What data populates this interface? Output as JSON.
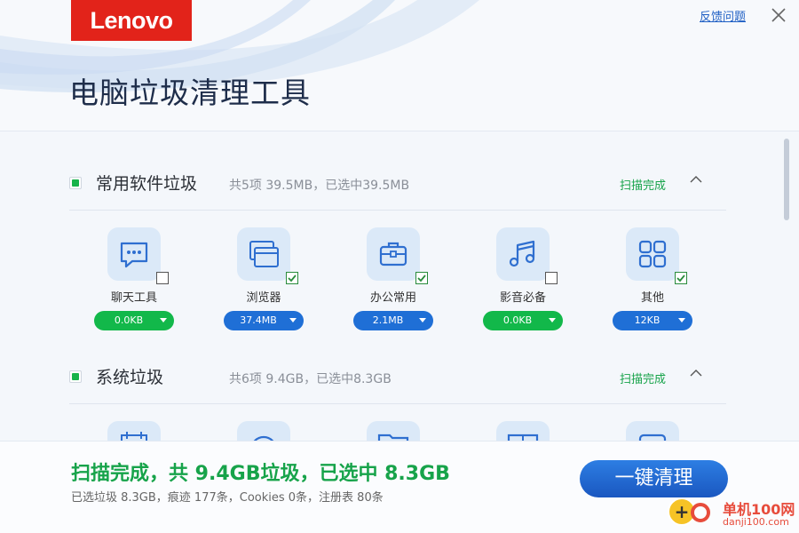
{
  "header": {
    "logo_text": "Lenovo",
    "feedback_label": "反馈问题",
    "title": "电脑垃圾清理工具"
  },
  "sections": [
    {
      "title": "常用软件垃圾",
      "info": "共5项 39.5MB，已选中39.5MB",
      "status": "扫描完成",
      "checked": true,
      "items": [
        {
          "label": "聊天工具",
          "size": "0.0KB",
          "checked": false,
          "pill_color": "green",
          "icon": "chat-bubble-icon"
        },
        {
          "label": "浏览器",
          "size": "37.4MB",
          "checked": true,
          "pill_color": "blue",
          "icon": "browser-windows-icon"
        },
        {
          "label": "办公常用",
          "size": "2.1MB",
          "checked": true,
          "pill_color": "blue",
          "icon": "briefcase-icon"
        },
        {
          "label": "影音必备",
          "size": "0.0KB",
          "checked": false,
          "pill_color": "green",
          "icon": "music-note-icon"
        },
        {
          "label": "其他",
          "size": "12KB",
          "checked": true,
          "pill_color": "blue",
          "icon": "grid-apps-icon"
        }
      ]
    },
    {
      "title": "系统垃圾",
      "info": "共6项 9.4GB，已选中8.3GB",
      "status": "扫描完成",
      "checked": true
    }
  ],
  "footer": {
    "summary": "扫描完成，共 9.4GB垃圾，已选中 8.3GB",
    "detail": "已选垃圾 8.3GB，痕迹 177条，Cookies 0条，注册表 80条",
    "clean_label": "一键清理"
  },
  "watermark": {
    "cn": "单机100网",
    "en": "danji100.com"
  },
  "colors": {
    "accent_blue": "#1f6fd6",
    "success_green": "#17a34a",
    "brand_red": "#e2231a"
  }
}
